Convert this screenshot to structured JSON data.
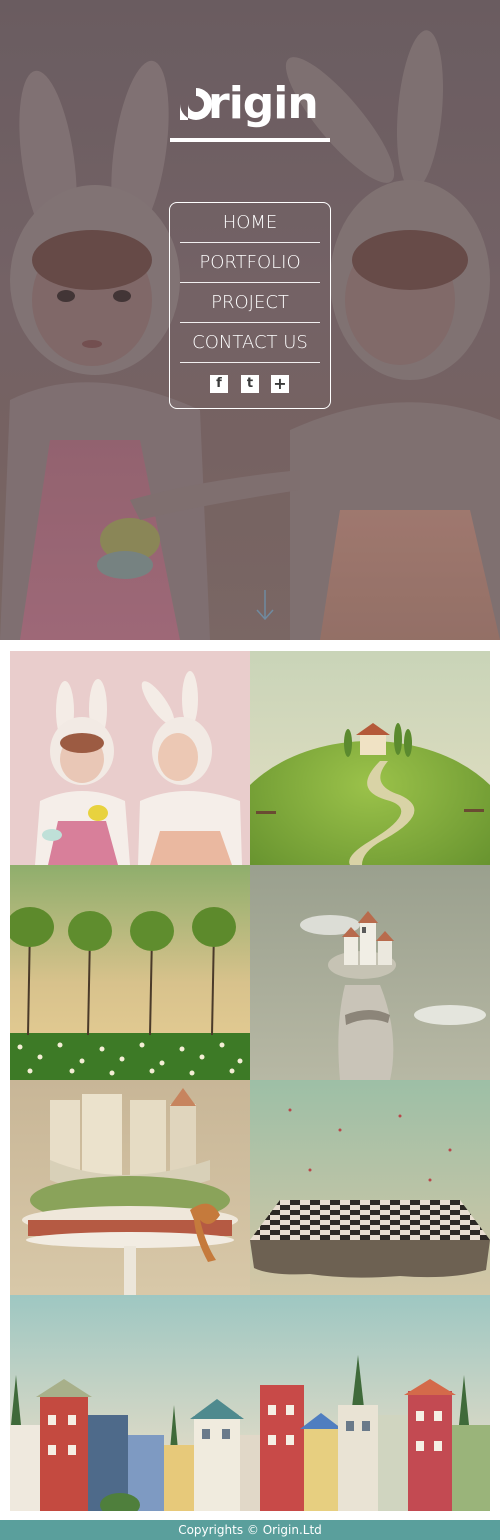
{
  "brand": {
    "name": "rigin",
    "accent_white": "#ffffff"
  },
  "nav": {
    "items": [
      {
        "label": "HOME"
      },
      {
        "label": "PORTFOLIO"
      },
      {
        "label": "PROJECT"
      },
      {
        "label": "CONTACT US"
      }
    ],
    "social": [
      {
        "icon": "facebook-icon",
        "glyph": "f"
      },
      {
        "icon": "twitter-icon",
        "glyph": "t"
      },
      {
        "icon": "google-plus-icon",
        "glyph": "+"
      }
    ]
  },
  "hero": {
    "scroll_icon": "arrow-down-icon"
  },
  "gallery": {
    "tiles": [
      {
        "subject": "bunny-girls"
      },
      {
        "subject": "hill-house"
      },
      {
        "subject": "trees-row"
      },
      {
        "subject": "castle-tower"
      },
      {
        "subject": "castle-cake"
      },
      {
        "subject": "checkerboard"
      },
      {
        "subject": "village-houses"
      }
    ]
  },
  "footer": {
    "copyright": "Copyrights © Origin.Ltd",
    "bg_color": "#5a9f9c"
  }
}
